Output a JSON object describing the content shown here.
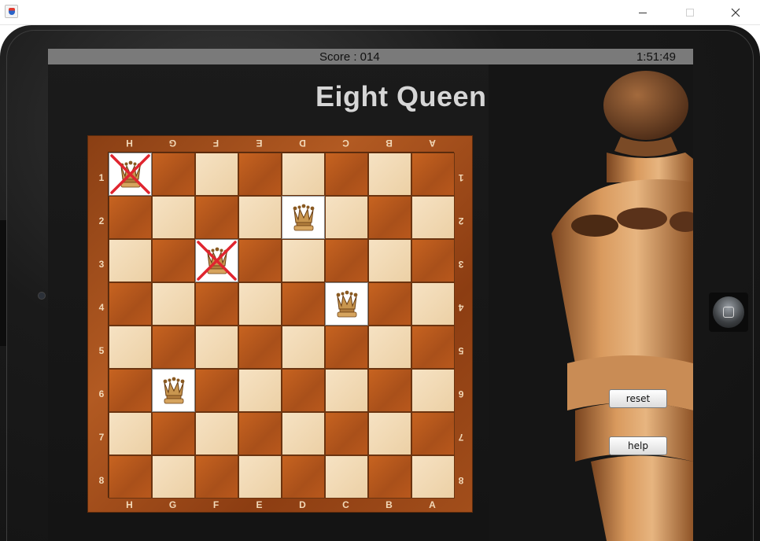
{
  "window": {
    "title": ""
  },
  "status": {
    "score": "Score : 014",
    "time": "1:51:49"
  },
  "game": {
    "title": "Eight Queen"
  },
  "board": {
    "files_top": [
      "H",
      "G",
      "F",
      "E",
      "D",
      "C",
      "B",
      "A"
    ],
    "files_bottom": [
      "H",
      "G",
      "F",
      "E",
      "D",
      "C",
      "B",
      "A"
    ],
    "ranks": [
      "1",
      "2",
      "3",
      "4",
      "5",
      "6",
      "7",
      "8"
    ],
    "queens": [
      {
        "row": 1,
        "col": 1,
        "conflict": true
      },
      {
        "row": 2,
        "col": 5,
        "conflict": false
      },
      {
        "row": 3,
        "col": 3,
        "conflict": true
      },
      {
        "row": 4,
        "col": 6,
        "conflict": false
      },
      {
        "row": 6,
        "col": 2,
        "conflict": false
      }
    ]
  },
  "buttons": {
    "reset": "reset",
    "help": "help"
  },
  "colors": {
    "conflict_mark": "#e0252f",
    "board_frame": "#9a4618",
    "light_square": "#f3dcb8",
    "dark_square": "#b9581c"
  }
}
